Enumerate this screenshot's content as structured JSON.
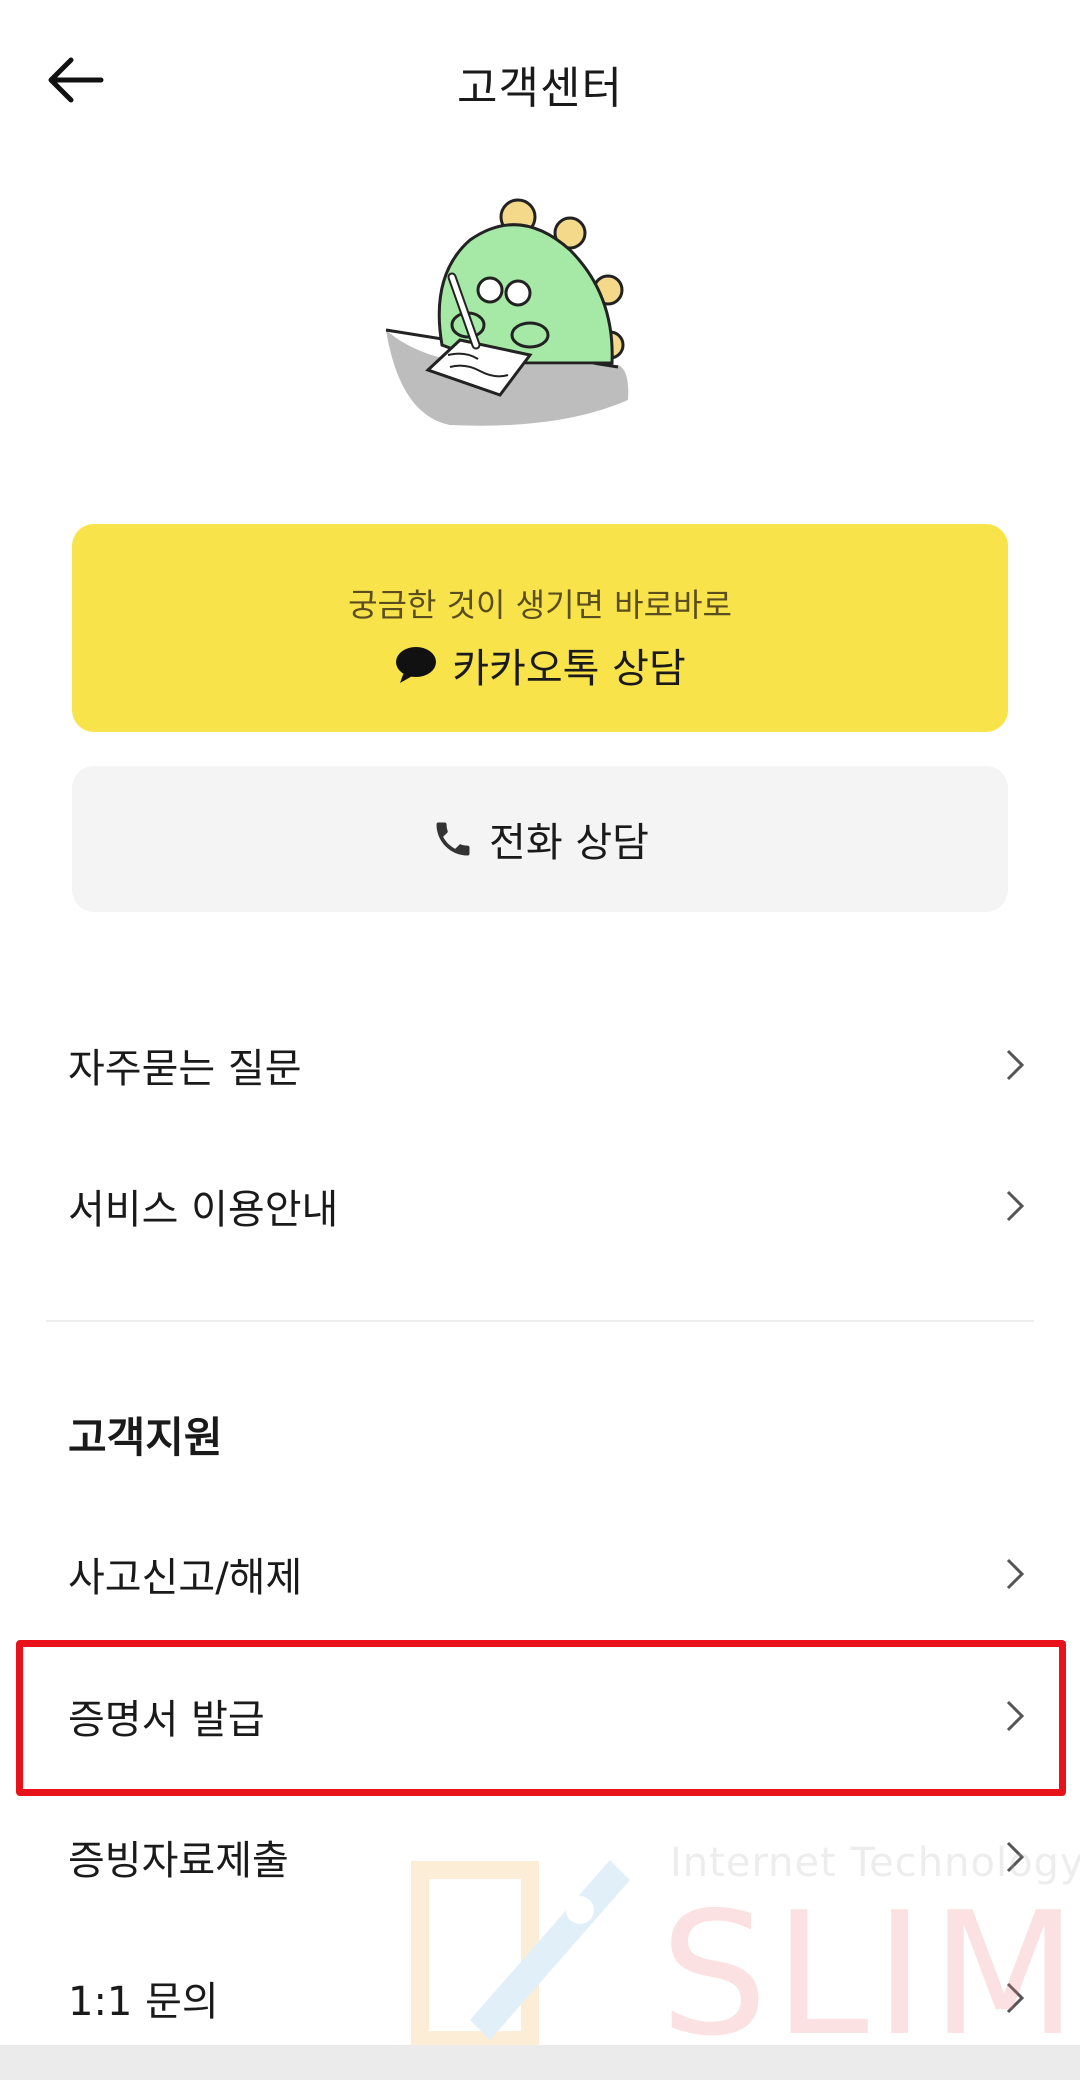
{
  "header": {
    "title": "고객센터"
  },
  "consult": {
    "kakao_sub": "궁금한 것이 생기면 바로바로",
    "kakao_label": "카카오톡 상담",
    "phone_label": "전화 상담"
  },
  "menu": {
    "items": [
      {
        "label": "자주묻는 질문"
      },
      {
        "label": "서비스 이용안내"
      }
    ]
  },
  "support": {
    "title": "고객지원",
    "items": [
      {
        "label": "사고신고/해제"
      },
      {
        "label": "증명서 발급"
      },
      {
        "label": "증빙자료제출"
      },
      {
        "label": "1:1 문의"
      }
    ]
  },
  "watermark": {
    "top": "Internet Technology",
    "main": "SLIM"
  },
  "colors": {
    "kakao_yellow": "#f8e34b",
    "phone_gray": "#f3f4f3",
    "highlight_red": "#e8121b"
  }
}
